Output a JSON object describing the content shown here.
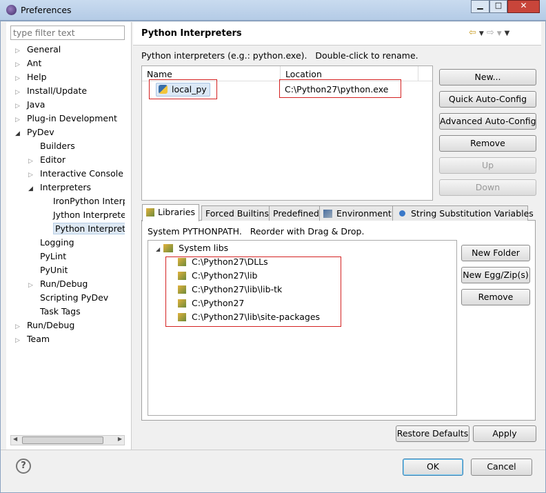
{
  "window": {
    "title": "Preferences"
  },
  "sidebar": {
    "filter_placeholder": "type filter text",
    "items": [
      {
        "label": "General",
        "level": 0,
        "state": "collapsed"
      },
      {
        "label": "Ant",
        "level": 0,
        "state": "collapsed"
      },
      {
        "label": "Help",
        "level": 0,
        "state": "collapsed"
      },
      {
        "label": "Install/Update",
        "level": 0,
        "state": "collapsed"
      },
      {
        "label": "Java",
        "level": 0,
        "state": "collapsed"
      },
      {
        "label": "Plug-in Development",
        "level": 0,
        "state": "collapsed"
      },
      {
        "label": "PyDev",
        "level": 0,
        "state": "expanded"
      },
      {
        "label": "Builders",
        "level": 1,
        "state": "leaf"
      },
      {
        "label": "Editor",
        "level": 1,
        "state": "collapsed"
      },
      {
        "label": "Interactive Console",
        "level": 1,
        "state": "collapsed"
      },
      {
        "label": "Interpreters",
        "level": 1,
        "state": "expanded"
      },
      {
        "label": "IronPython Interpreter",
        "level": 2,
        "state": "leaf"
      },
      {
        "label": "Jython Interpreter",
        "level": 2,
        "state": "leaf"
      },
      {
        "label": "Python Interpreter",
        "level": 2,
        "state": "leaf",
        "selected": true
      },
      {
        "label": "Logging",
        "level": 1,
        "state": "leaf"
      },
      {
        "label": "PyLint",
        "level": 1,
        "state": "leaf"
      },
      {
        "label": "PyUnit",
        "level": 1,
        "state": "leaf"
      },
      {
        "label": "Run/Debug",
        "level": 1,
        "state": "collapsed"
      },
      {
        "label": "Scripting PyDev",
        "level": 1,
        "state": "leaf"
      },
      {
        "label": "Task Tags",
        "level": 1,
        "state": "leaf"
      },
      {
        "label": "Run/Debug",
        "level": 0,
        "state": "collapsed"
      },
      {
        "label": "Team",
        "level": 0,
        "state": "collapsed"
      }
    ]
  },
  "main": {
    "title": "Python Interpreters",
    "description": "Python interpreters (e.g.: python.exe).   Double-click to rename.",
    "table": {
      "columns": [
        "Name",
        "Location"
      ],
      "rows": [
        {
          "name": "local_py",
          "location": "C:\\Python27\\python.exe"
        }
      ]
    },
    "buttons": [
      "New...",
      "Quick Auto-Config",
      "Advanced Auto-Config",
      "Remove",
      "Up",
      "Down"
    ],
    "tabs": [
      "Libraries",
      "Forced Builtins",
      "Predefined",
      "Environment",
      "String Substitution Variables"
    ],
    "tab_description": "System PYTHONPATH.   Reorder with Drag & Drop.",
    "libs_root": "System libs",
    "libs": [
      "C:\\Python27\\DLLs",
      "C:\\Python27\\lib",
      "C:\\Python27\\lib\\lib-tk",
      "C:\\Python27",
      "C:\\Python27\\lib\\site-packages"
    ],
    "lib_buttons": [
      "New Folder",
      "New Egg/Zip(s)",
      "Remove"
    ],
    "restore_defaults": "Restore Defaults",
    "apply": "Apply"
  },
  "footer": {
    "help": "?",
    "ok": "OK",
    "cancel": "Cancel"
  },
  "colors": {
    "highlight": "#d42020"
  }
}
